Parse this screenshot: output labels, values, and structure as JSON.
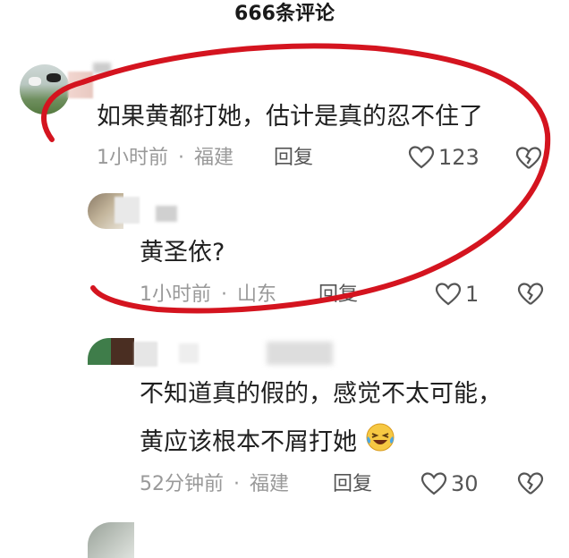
{
  "header": {
    "title": "666条评论"
  },
  "comments": [
    {
      "text": "如果黄都打她，估计是真的忍不住了",
      "time": "1小时前",
      "location": "福建",
      "reply_label": "回复",
      "likes": "123"
    },
    {
      "text": "黄圣依?",
      "time": "1小时前",
      "location": "山东",
      "reply_label": "回复",
      "likes": "1"
    },
    {
      "text_line1": "不知道真的假的，感觉不太可能，",
      "text_line2": "黄应该根本不屑打她",
      "time": "52分钟前",
      "location": "福建",
      "reply_label": "回复",
      "likes": "30"
    }
  ],
  "separator": "·",
  "icons": {
    "like": "heart-outline-icon",
    "dislike": "broken-heart-icon",
    "emoji": "laughing-tears-emoji"
  },
  "colors": {
    "annotation": "#d4141f",
    "meta": "#999999"
  }
}
